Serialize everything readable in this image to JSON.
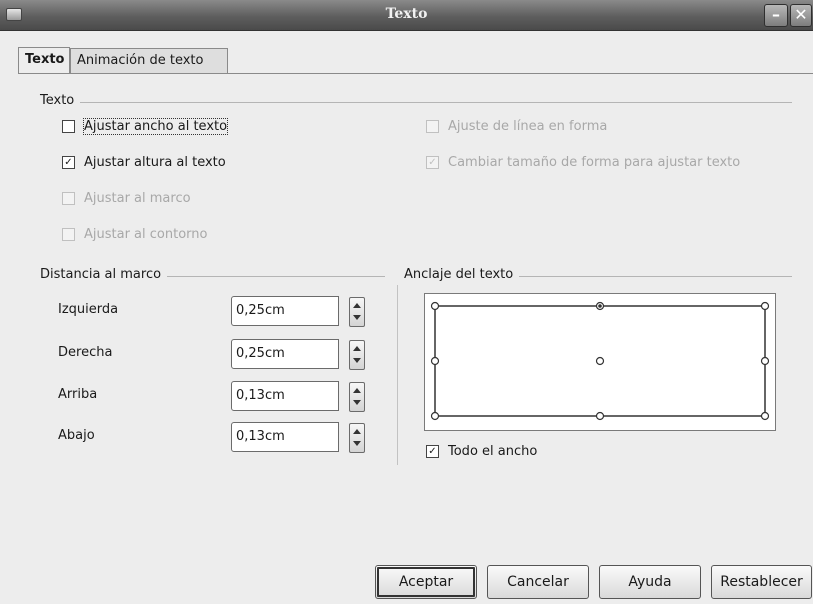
{
  "window": {
    "title": "Texto"
  },
  "tabs": [
    {
      "label": "Texto",
      "active": true
    },
    {
      "label": "Animación de texto",
      "active": false
    }
  ],
  "texto_section": {
    "title": "Texto",
    "options": [
      {
        "label": "Ajustar ancho al texto",
        "checked": false,
        "enabled": true
      },
      {
        "label": "Ajustar altura al texto",
        "checked": true,
        "enabled": true
      },
      {
        "label": "Ajustar al marco",
        "checked": false,
        "enabled": false
      },
      {
        "label": "Ajustar al contorno",
        "checked": false,
        "enabled": false
      },
      {
        "label": "Ajuste de línea en forma",
        "checked": false,
        "enabled": false
      },
      {
        "label": "Cambiar tamaño de forma para ajustar texto",
        "checked": true,
        "enabled": false
      }
    ]
  },
  "distancia_section": {
    "title": "Distancia al marco",
    "fields": [
      {
        "label": "Izquierda",
        "value": "0,25cm"
      },
      {
        "label": "Derecha",
        "value": "0,25cm"
      },
      {
        "label": "Arriba",
        "value": "0,13cm"
      },
      {
        "label": "Abajo",
        "value": "0,13cm"
      }
    ]
  },
  "anclaje_section": {
    "title": "Anclaje del texto",
    "selected_anchor": "top-center",
    "full_width": {
      "label": "Todo el ancho",
      "checked": true
    }
  },
  "buttons": {
    "ok": "Aceptar",
    "cancel": "Cancelar",
    "help": "Ayuda",
    "reset": "Restablecer"
  },
  "icons": {
    "close": "close-icon",
    "minimize": "minimize-icon",
    "app": "app-icon"
  }
}
